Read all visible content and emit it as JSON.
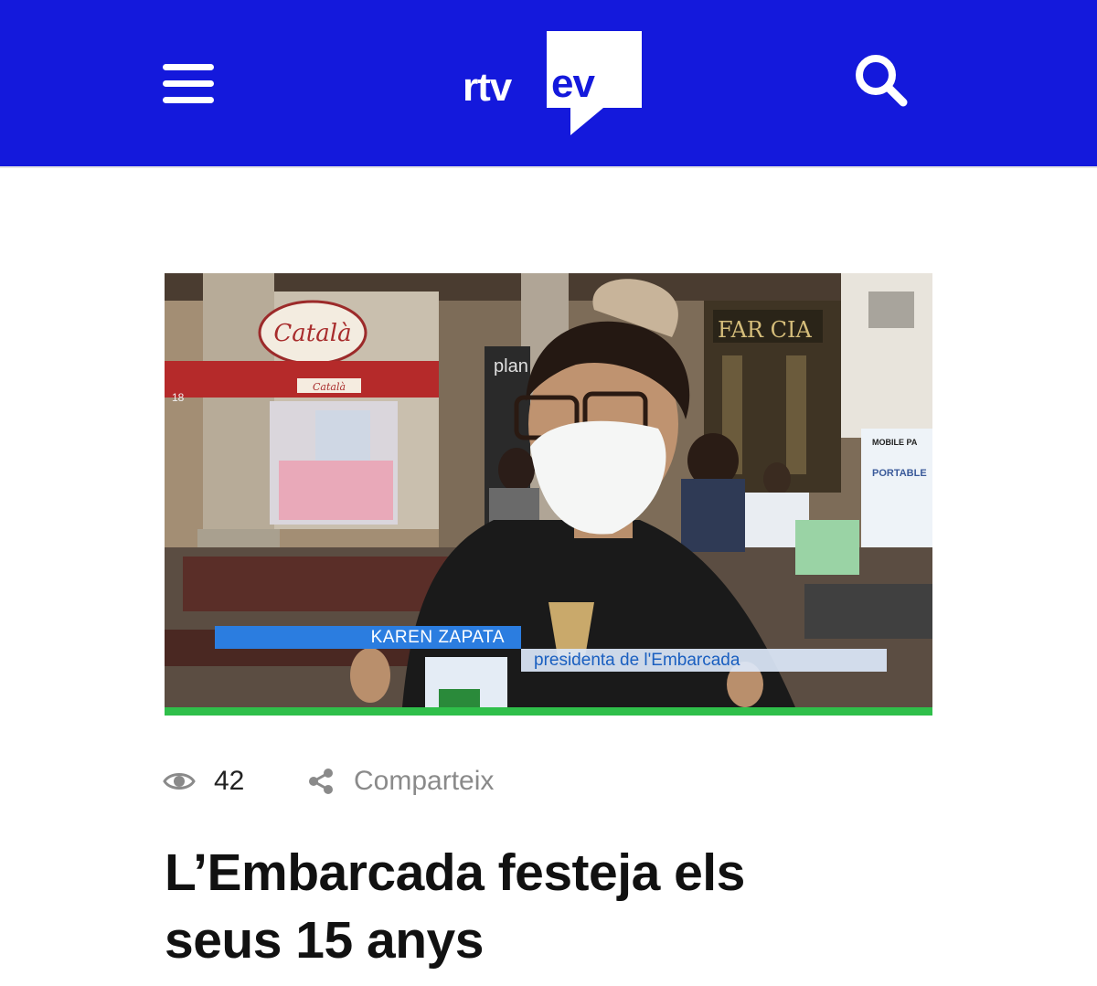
{
  "header": {
    "logo_left": "rtv",
    "logo_right": "ev",
    "brand_color": "#1419dc",
    "menu_icon": "hamburger-icon",
    "search_icon": "search-icon"
  },
  "video": {
    "storefront_sign": "Català",
    "awning_text": "Català",
    "pharmacy_sign": "FAR  CIA",
    "shop_sign": "plan",
    "door_number": "18",
    "board_top": "MOBILE PA",
    "board_sub": "PORTABLE",
    "lower_third_name": "KAREN ZAPATA",
    "lower_third_role": "presidenta de l'Embarcada",
    "progress_color": "#2fbf4a"
  },
  "meta": {
    "views_icon": "eye-icon",
    "views": "42",
    "share_icon": "share-icon",
    "share_label": "Comparteix"
  },
  "article": {
    "title_line1": "L’Embarcada festeja els",
    "title_line2": "seus 15 anys"
  }
}
